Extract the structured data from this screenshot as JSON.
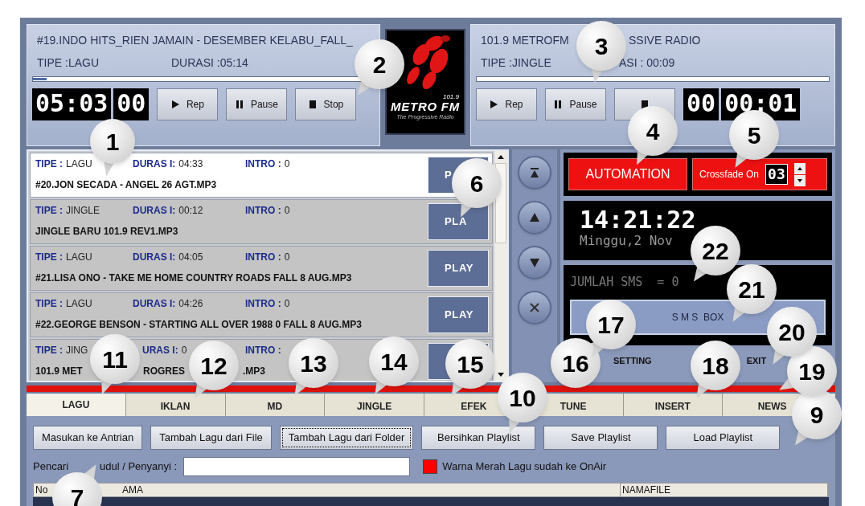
{
  "decks": [
    {
      "title_parts": [
        "#19.INDO HITS_RIEN JAMAIN - DESEMBER KELABU_FALL_"
      ],
      "tipe": "TIPE :LAGU",
      "durasi": "DURASI :05:14",
      "level": 0.04,
      "displays": [
        "05:03",
        "00"
      ],
      "buttons": [
        {
          "kind": "play",
          "label": "Rep"
        },
        {
          "kind": "pause",
          "label": "Pause"
        },
        {
          "kind": "stop",
          "label": "Stop"
        }
      ]
    },
    {
      "title_parts": [
        "101.9 METROFM",
        "SSIVE RADIO"
      ],
      "tipe": "TIPE :JINGLE",
      "durasi": "ASI : 00:09",
      "level": 0,
      "displays": [
        "00",
        "00:01"
      ],
      "buttons": [
        {
          "kind": "play",
          "label": "Rep"
        },
        {
          "kind": "pause",
          "label": "Pause"
        },
        {
          "kind": "stop"
        }
      ]
    }
  ],
  "logo": {
    "frequency": "101.9",
    "name": "METRO FM",
    "tagline": "The Progressive Radio"
  },
  "playlist": [
    {
      "selected": true,
      "tipe_label": "TIPE :",
      "tipe": "LAGU",
      "durasi_label": "DURAS I:",
      "durasi": "04:33",
      "intro_label": "INTRO :",
      "intro": "0",
      "file_parts": [
        "#20.JON SECADA - ANGEL  26 AGT.MP3"
      ],
      "button": "P"
    },
    {
      "selected": false,
      "tipe_label": "TIPE :",
      "tipe": "JINGLE",
      "durasi_label": "DURAS I:",
      "durasi": "00:12",
      "intro_label": "INTRO :",
      "intro": "0",
      "file_parts": [
        "JINGLE BARU 101.9 REV1.MP3"
      ],
      "button": "PLA"
    },
    {
      "selected": false,
      "tipe_label": "TIPE :",
      "tipe": "LAGU",
      "durasi_label": "DURAS I:",
      "durasi": "04:05",
      "intro_label": "INTRO :",
      "intro": "0",
      "file_parts": [
        "#21.LISA ONO - TAKE ME HOME COUNTRY ROADS  FALL  8 AUG.MP3"
      ],
      "button": "PLAY"
    },
    {
      "selected": false,
      "tipe_label": "TIPE :",
      "tipe": "LAGU",
      "durasi_label": "DURAS I:",
      "durasi": "04:26",
      "intro_label": "INTRO :",
      "intro": "0",
      "file_parts": [
        "#22.GEORGE BENSON - STARTING ALL OVER   1988  0  FALL  8 AUG.MP3"
      ],
      "button": "PLAY"
    },
    {
      "selected": false,
      "tipe_label": "TIPE :",
      "tipe": "JING",
      "durasi_label": "URAS I:",
      "durasi": "0",
      "intro_label": "INTRO :",
      "file_parts": [
        "101.9 MET",
        "ROGRES",
        ".MP3"
      ]
    }
  ],
  "nav_buttons": [
    {
      "kind": "top"
    },
    {
      "kind": "up"
    },
    {
      "kind": "down"
    },
    {
      "kind": "remove"
    }
  ],
  "automation": {
    "label": "AUTOMATION",
    "on": true
  },
  "crossfade": {
    "label": "Crossfade On",
    "on": true,
    "value": "03"
  },
  "clock": {
    "time": "14:21:22",
    "date": "Minggu,2 Nov"
  },
  "sms": {
    "count": "JUMLAH SMS  = 0",
    "button": "S M S  BOX"
  },
  "footer_buttons": [
    "SETTING",
    "EXIT"
  ],
  "tabs": [
    {
      "label": "LAGU",
      "selected": true
    },
    {
      "label": "IKLAN",
      "selected": false
    },
    {
      "label": "MD",
      "selected": false
    },
    {
      "label": "JINGLE",
      "selected": false
    },
    {
      "label": "EFEK",
      "selected": false
    },
    {
      "label": "TUNE",
      "selected": false
    },
    {
      "label": "INSERT",
      "selected": false
    },
    {
      "label": "NEWS",
      "selected": false
    }
  ],
  "actions": [
    {
      "label": "Masukan ke Antrian",
      "focused": false
    },
    {
      "label": "Tambah Lagu dari File",
      "focused": false
    },
    {
      "label": "Tambah Lagu dari Folder",
      "focused": true
    },
    {
      "label": "Bersihkan Playlist",
      "focused": false
    },
    {
      "label": "Save Playlist",
      "focused": false
    },
    {
      "label": "Load Playlist",
      "focused": false
    }
  ],
  "search": {
    "label_parts": [
      "Pencari",
      "udul / Penyanyi :"
    ]
  },
  "legend": {
    "color": "#ff0000",
    "label": "Warna Merah Lagu sudah ke OnAir"
  },
  "table": {
    "columns": [
      "No",
      "AMA",
      "NAMAFILE"
    ]
  },
  "callouts": [
    "1",
    "2",
    "3",
    "4",
    "5",
    "6",
    "7",
    "9",
    "10",
    "11",
    "12",
    "13",
    "14",
    "15",
    "16",
    "17",
    "18",
    "19",
    "20",
    "21",
    "22"
  ]
}
